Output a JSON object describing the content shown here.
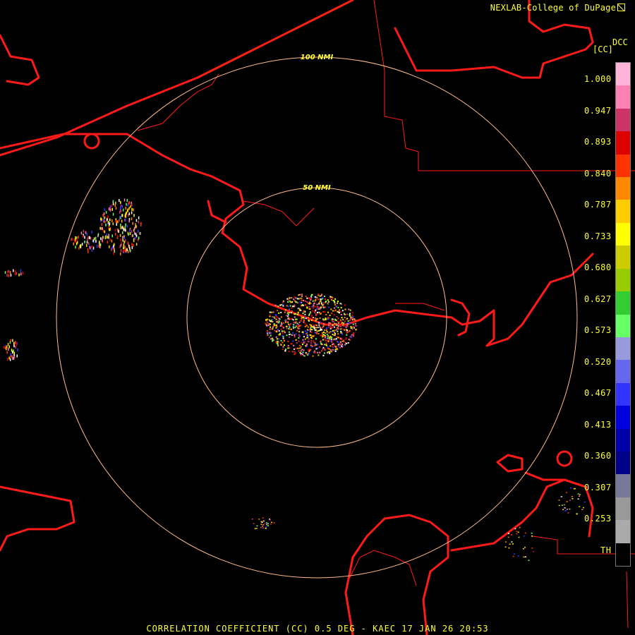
{
  "credit": "NEXLAB-College of DuPage",
  "credit_icon": "external-link-icon",
  "legend": {
    "product": "DCC",
    "unit": "[CC]",
    "ticks": [
      "1.000",
      "0.947",
      "0.893",
      "0.840",
      "0.787",
      "0.733",
      "0.680",
      "0.627",
      "0.573",
      "0.520",
      "0.467",
      "0.413",
      "0.360",
      "0.307",
      "0.253",
      "TH"
    ],
    "colors": [
      "#ffb3d9",
      "#ff80b3",
      "#cc3366",
      "#dd0000",
      "#ff3300",
      "#ff8800",
      "#ffcc00",
      "#ffff00",
      "#cccc00",
      "#99cc00",
      "#33cc33",
      "#66ff66",
      "#9999dd",
      "#6666ee",
      "#3333ff",
      "#0000dd",
      "#0000aa",
      "#000088",
      "#777799",
      "#999999",
      "#aaaaaa",
      "#000000"
    ]
  },
  "rings": [
    {
      "label": "50 NMI"
    },
    {
      "label": "100 NMI"
    }
  ],
  "footer": "CORRELATION COEFFICIENT (CC) 0.5 DEG - KAEC 17 JAN 26 20:53",
  "colors": {
    "background": "#000000",
    "coastline": "#ff1a1a",
    "ring": "#ffbb88",
    "text": "#ffff33"
  }
}
